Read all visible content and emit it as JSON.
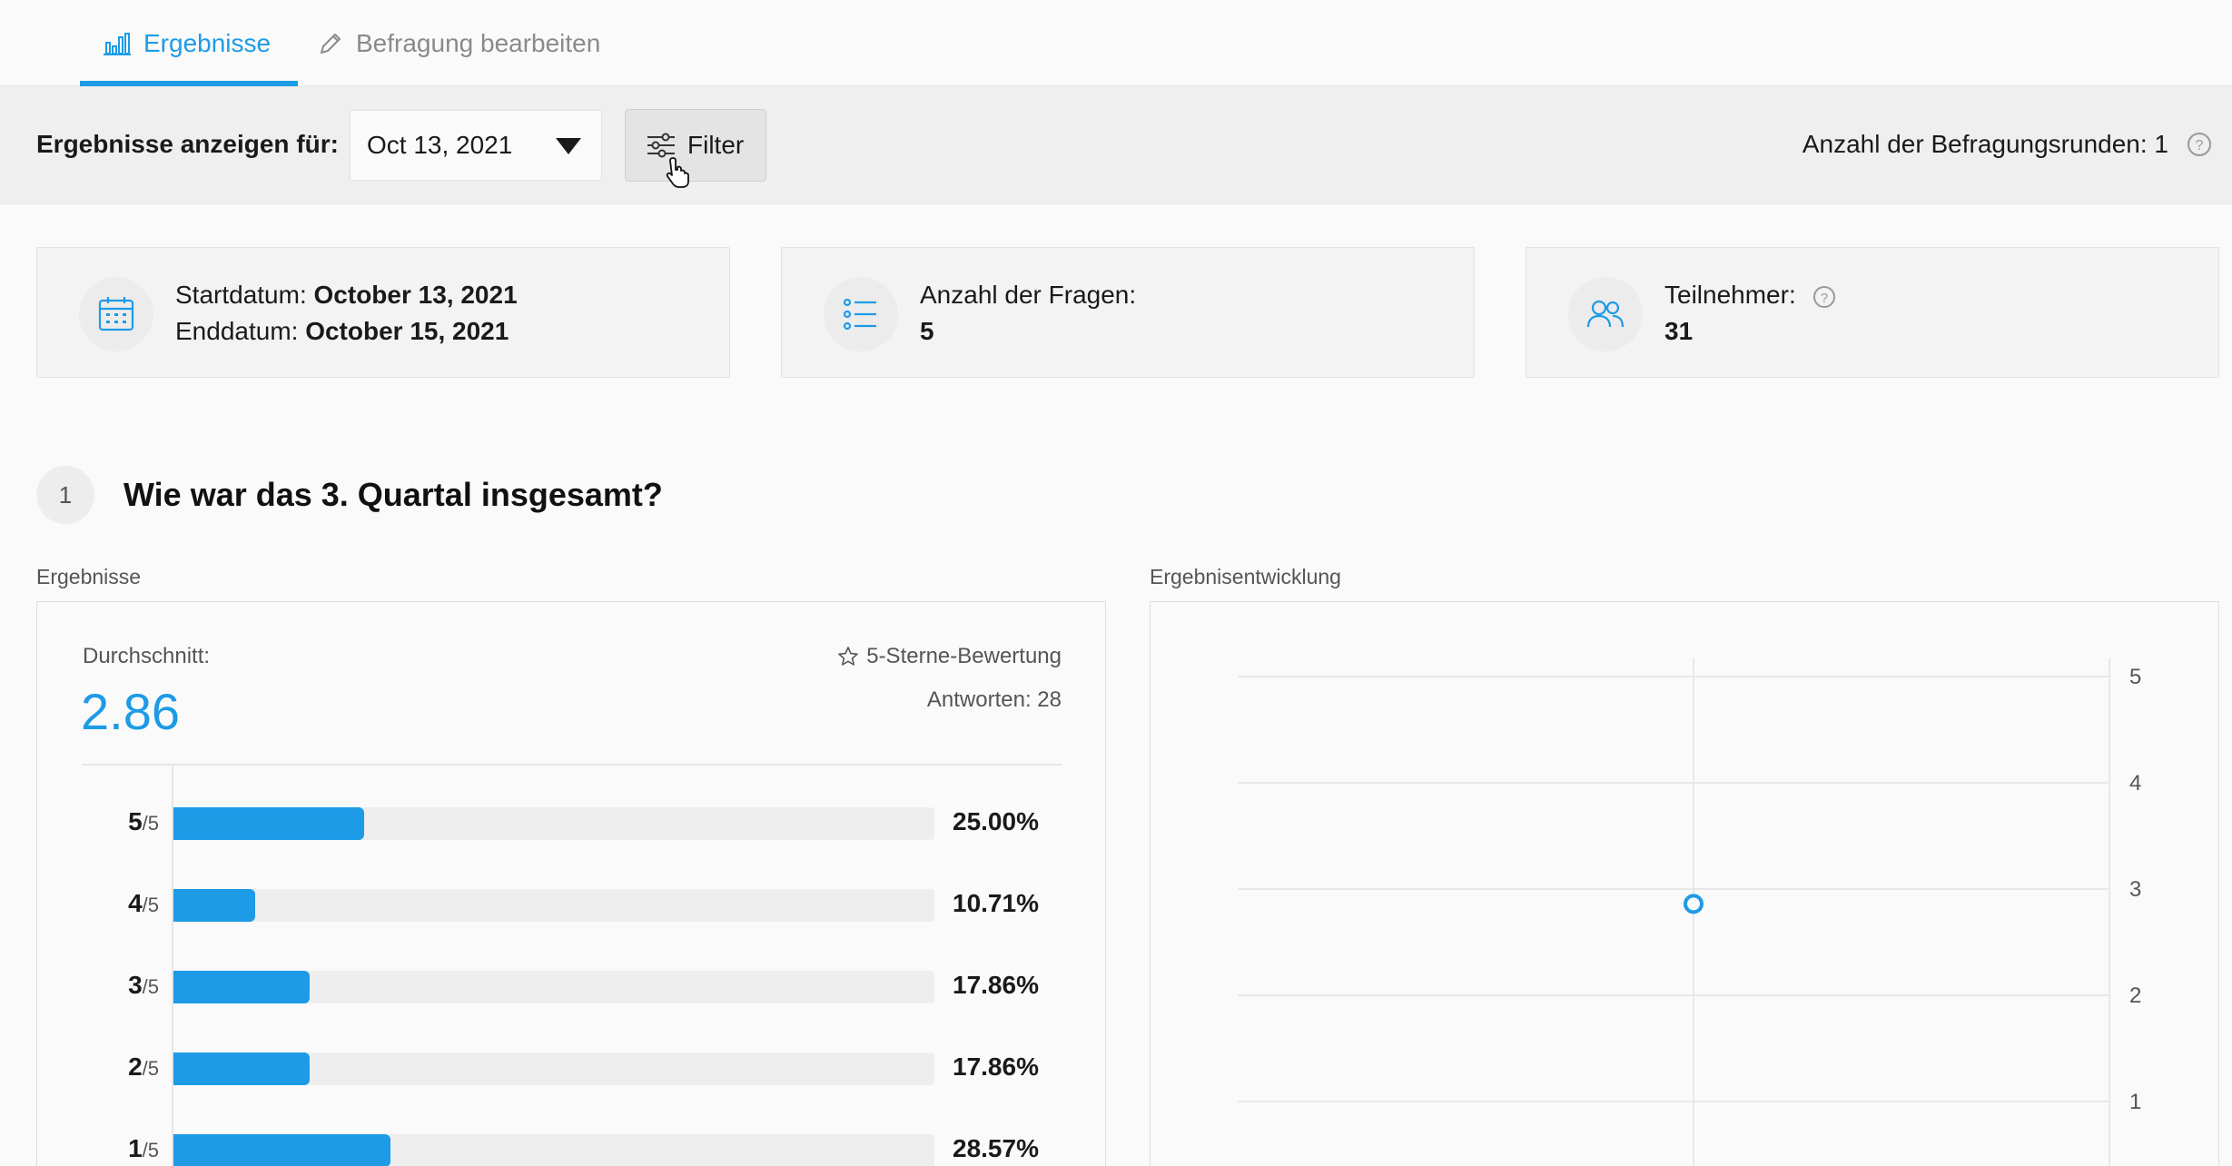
{
  "tabs": [
    {
      "label": "Ergebnisse",
      "icon": "bar-chart-icon",
      "active": true
    },
    {
      "label": "Befragung bearbeiten",
      "icon": "pencil-icon",
      "active": false
    }
  ],
  "filterbar": {
    "label": "Ergebnisse anzeigen für:",
    "selected_date": "Oct 13, 2021",
    "filter_button": "Filter",
    "rounds": "Anzahl der Befragungsrunden: 1"
  },
  "cards": {
    "dates": {
      "start_label": "Startdatum:",
      "start_value": "October 13, 2021",
      "end_label": "Enddatum:",
      "end_value": "October 15, 2021"
    },
    "questions": {
      "label": "Anzahl der Fragen:",
      "value": "5"
    },
    "participants": {
      "label": "Teilnehmer:",
      "value": "31"
    }
  },
  "question": {
    "number": "1",
    "title": "Wie war das 3. Quartal insgesamt?"
  },
  "results": {
    "section_label": "Ergebnisse",
    "avg_label": "Durchschnitt:",
    "avg_value": "2.86",
    "rating_type": "5-Sterne-Bewertung",
    "answers": "Antworten: 28",
    "rows": [
      {
        "score": "5",
        "suffix": "/5",
        "pct": "25.00%",
        "fraction": 0.25
      },
      {
        "score": "4",
        "suffix": "/5",
        "pct": "10.71%",
        "fraction": 0.1071
      },
      {
        "score": "3",
        "suffix": "/5",
        "pct": "17.86%",
        "fraction": 0.1786
      },
      {
        "score": "2",
        "suffix": "/5",
        "pct": "17.86%",
        "fraction": 0.1786
      },
      {
        "score": "1",
        "suffix": "/5",
        "pct": "28.57%",
        "fraction": 0.2857
      }
    ]
  },
  "trend": {
    "section_label": "Ergebnisentwicklung"
  },
  "chart_data": {
    "type": "scatter",
    "title": "",
    "xlabel": "",
    "ylabel": "",
    "ylim": [
      0,
      5
    ],
    "y_ticks": [
      "1",
      "2",
      "3",
      "4",
      "5"
    ],
    "series": [
      {
        "values": [
          2.86
        ]
      }
    ],
    "grid": true
  },
  "colors": {
    "accent": "#1d9be6",
    "track": "#eeeeee"
  }
}
